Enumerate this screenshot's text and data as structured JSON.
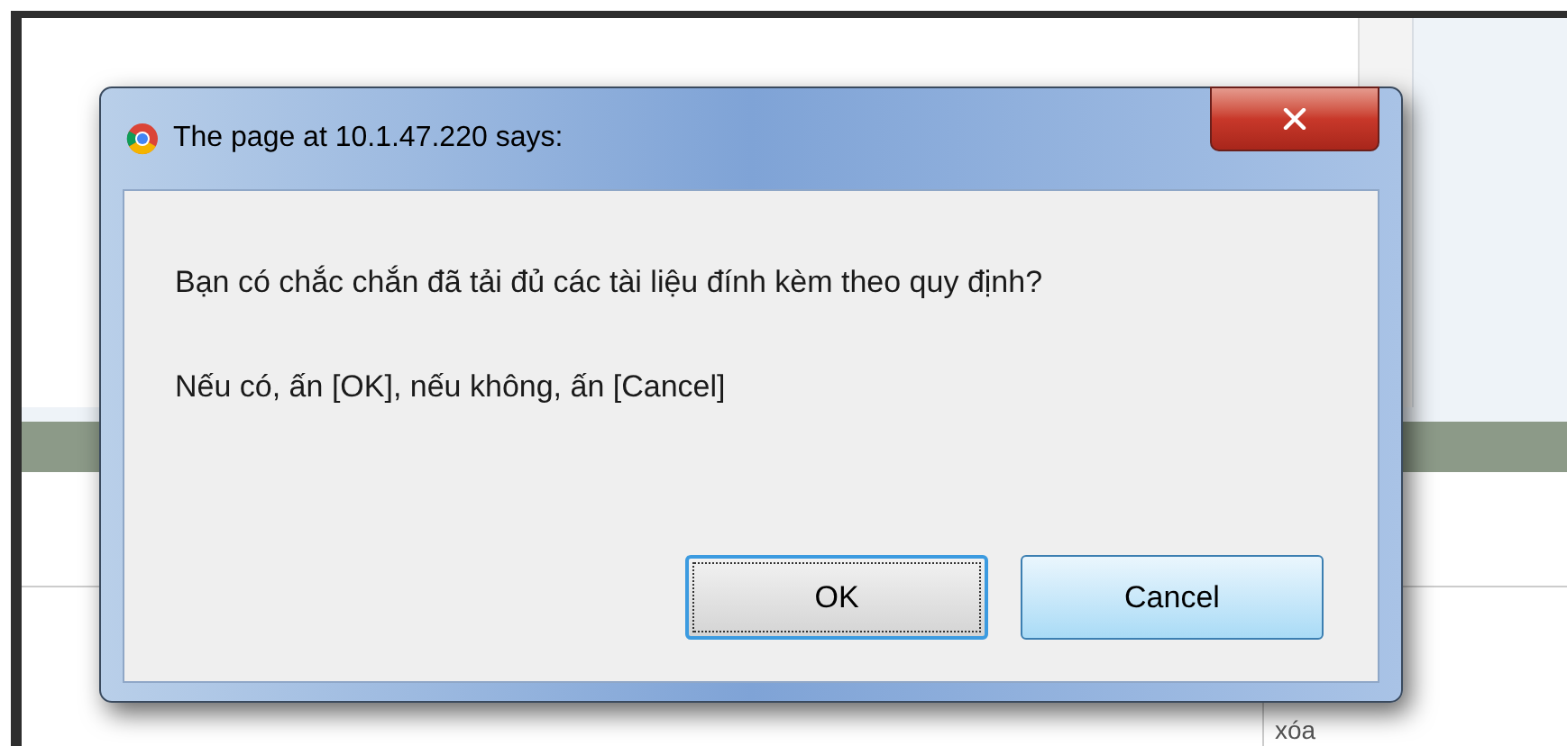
{
  "background": {
    "cell_text": "xóa"
  },
  "dialog": {
    "title": "The page at 10.1.47.220 says:",
    "message": "Bạn có chắc chắn đã tải đủ các tài liệu đính kèm theo quy định?",
    "note": "Nếu có, ấn [OK], nếu không, ấn [Cancel]",
    "buttons": [
      {
        "label": "OK",
        "selected": true
      },
      {
        "label": "Cancel",
        "selected": false
      }
    ]
  }
}
